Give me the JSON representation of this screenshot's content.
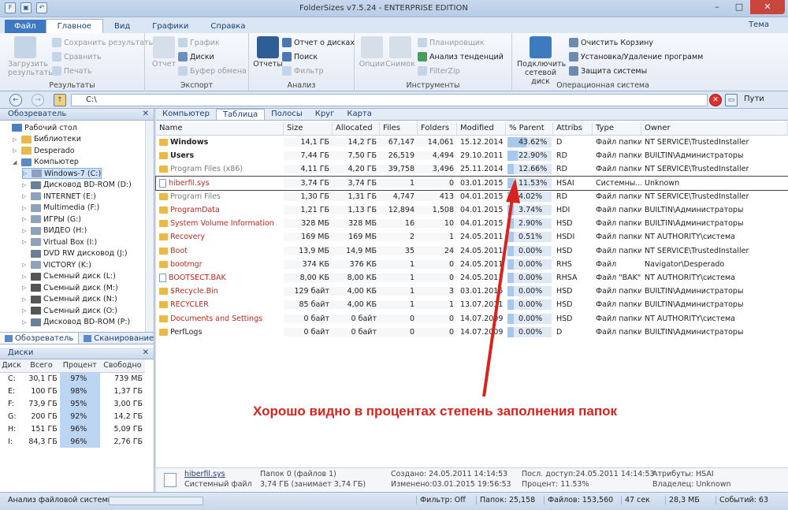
{
  "window": {
    "title": "FolderSizes v7.5.24 - ENTERPRISE EDITION",
    "theme_label": "Тема"
  },
  "ribbon_tabs": [
    "Файл",
    "Главное",
    "Вид",
    "Графики",
    "Справка"
  ],
  "ribbon": {
    "results": {
      "load": "Загрузить результаты",
      "save": "Сохранить результаты",
      "compare": "Сравнить",
      "print": "Печать",
      "label": "Результаты"
    },
    "export": {
      "report": "Отчет",
      "chart": "График",
      "disks": "Диски",
      "clipboard": "Буфер обмена",
      "label": "Экспорт"
    },
    "analysis": {
      "reports": "Отчеты",
      "disk_report": "Отчет о дисках",
      "search": "Поиск",
      "filter": "Фильтр",
      "label": "Анализ"
    },
    "tools": {
      "options": "Опции",
      "snapshot": "Снимок",
      "planner": "Планировщик",
      "trend": "Анализ тенденций",
      "filterzip": "FilterZip",
      "label": "Инструменты"
    },
    "os": {
      "network": "Подключить сетевой диск",
      "recycle": "Очистить Корзину",
      "install": "Установка/Удаление программ",
      "protect": "Защита системы",
      "label": "Операционная система"
    }
  },
  "address": {
    "path": "C:\\",
    "paths_label": "Пути"
  },
  "explorer": {
    "title": "Обозреватель",
    "tree": [
      "Рабочий стол",
      "Библиотеки",
      "Desperado",
      "Компьютер",
      "Windows-7 (C:)",
      "Дисковод BD-ROM (D:)",
      "INTERNET (E:)",
      "Multimedia (F:)",
      "ИГРЫ (G:)",
      "ВИДЕО (H:)",
      "Virtual Box (I:)",
      "DVD RW дисковод (J:)",
      "VICTORY (K:)",
      "Съемный диск (L:)",
      "Съемный диск (M:)",
      "Съемный диск (N:)",
      "Съемный диск (O:)",
      "Дисковод BD-ROM (P:)"
    ],
    "tabs": [
      "Обозреватель",
      "Сканирование"
    ]
  },
  "disks": {
    "title": "Диски",
    "headers": [
      "Диск",
      "Всего",
      "Процент",
      "Свободно"
    ],
    "rows": [
      [
        "C:",
        "30,1 ГБ",
        "97%",
        "739 МБ"
      ],
      [
        "E:",
        "100 ГБ",
        "98%",
        "1,37 ГБ"
      ],
      [
        "F:",
        "73,9 ГБ",
        "95%",
        "3,00 ГБ"
      ],
      [
        "G:",
        "200 ГБ",
        "92%",
        "14,2 ГБ"
      ],
      [
        "H:",
        "151 ГБ",
        "96%",
        "5,09 ГБ"
      ],
      [
        "I:",
        "84,3 ГБ",
        "96%",
        "2,76 ГБ"
      ]
    ]
  },
  "view_tabs": [
    "Компьютер",
    "Таблица",
    "Полосы",
    "Круг",
    "Карта"
  ],
  "table": {
    "headers": [
      "Name",
      "Size",
      "Allocated",
      "Files",
      "Folders",
      "Modified",
      "% Parent",
      "Attribs",
      "Type",
      "Owner"
    ],
    "rows": [
      {
        "name": "Windows",
        "size": "14,1 ГБ",
        "alloc": "14,2 ГБ",
        "files": "67,147",
        "folders": "14,061",
        "mod": "15.12.2014 ...",
        "pct": "43.62%",
        "pv": 43.62,
        "attr": "D",
        "type": "Файл папки",
        "owner": "NT SERVICE\\TrustedInstaller",
        "style": "bold",
        "icon": "folder"
      },
      {
        "name": "Users",
        "size": "7,44 ГБ",
        "alloc": "7,50 ГБ",
        "files": "26,519",
        "folders": "4,494",
        "mod": "29.10.2011 ...",
        "pct": "22.90%",
        "pv": 22.9,
        "attr": "RD",
        "type": "Файл папки",
        "owner": "BUILTIN\\Администраторы",
        "style": "bold",
        "icon": "folder"
      },
      {
        "name": "Program Files (x86)",
        "size": "4,11 ГБ",
        "alloc": "4,20 ГБ",
        "files": "39,758",
        "folders": "3,496",
        "mod": "25.11.2014 ...",
        "pct": "12.66%",
        "pv": 12.66,
        "attr": "RD",
        "type": "Файл папки",
        "owner": "NT SERVICE\\TrustedInstaller",
        "style": "gray",
        "icon": "folder"
      },
      {
        "name": "hiberfil.sys",
        "size": "3,74 ГБ",
        "alloc": "3,74 ГБ",
        "files": "1",
        "folders": "0",
        "mod": "03.01.2015 ...",
        "pct": "11.53%",
        "pv": 11.53,
        "attr": "HSAI",
        "type": "Системны...",
        "owner": "Unknown",
        "style": "red",
        "icon": "file"
      },
      {
        "name": "Program Files",
        "size": "1,30 ГБ",
        "alloc": "1,31 ГБ",
        "files": "4,747",
        "folders": "413",
        "mod": "04.01.2015 ...",
        "pct": "4.02%",
        "pv": 4.02,
        "attr": "RD",
        "type": "Файл папки",
        "owner": "NT SERVICE\\TrustedInstaller",
        "style": "gray",
        "icon": "folder"
      },
      {
        "name": "ProgramData",
        "size": "1,21 ГБ",
        "alloc": "1,13 ГБ",
        "files": "12,894",
        "folders": "1,508",
        "mod": "04.01.2015 ...",
        "pct": "3.74%",
        "pv": 3.74,
        "attr": "HDI",
        "type": "Файл папки",
        "owner": "BUILTIN\\Администраторы",
        "style": "red",
        "icon": "folder"
      },
      {
        "name": "System Volume Information",
        "size": "328 МБ",
        "alloc": "328 МБ",
        "files": "16",
        "folders": "10",
        "mod": "04.01.2015 ...",
        "pct": "2.90%",
        "pv": 2.9,
        "attr": "HSD",
        "type": "Файл папки",
        "owner": "BUILTIN\\Администраторы",
        "style": "red",
        "icon": "folder"
      },
      {
        "name": "Recovery",
        "size": "169 МБ",
        "alloc": "169 МБ",
        "files": "2",
        "folders": "1",
        "mod": "24.05.2011 ...",
        "pct": "0.51%",
        "pv": 0.51,
        "attr": "HSDI",
        "type": "Файл папки",
        "owner": "NT AUTHORITY\\система",
        "style": "red",
        "icon": "folder"
      },
      {
        "name": "Boot",
        "size": "13,9 МБ",
        "alloc": "14,9 МБ",
        "files": "35",
        "folders": "24",
        "mod": "24.05.2011 ...",
        "pct": "0.00%",
        "pv": 0,
        "attr": "HSD",
        "type": "Файл папки",
        "owner": "NT SERVICE\\TrustedInstaller",
        "style": "red",
        "icon": "folder"
      },
      {
        "name": "bootmgr",
        "size": "374 КБ",
        "alloc": "376 КБ",
        "files": "1",
        "folders": "0",
        "mod": "24.05.2011 ...",
        "pct": "0.00%",
        "pv": 0,
        "attr": "RHS",
        "type": "Файл",
        "owner": "Navigator\\Desperado",
        "style": "red",
        "icon": "folder"
      },
      {
        "name": "BOOTSECT.BAK",
        "size": "8,00 КБ",
        "alloc": "8,00 КБ",
        "files": "1",
        "folders": "0",
        "mod": "24.05.2011 ...",
        "pct": "0.00%",
        "pv": 0,
        "attr": "RHSA",
        "type": "Файл \"BAK\"",
        "owner": "NT AUTHORITY\\система",
        "style": "red",
        "icon": "file"
      },
      {
        "name": "$Recycle.Bin",
        "size": "129 байт",
        "alloc": "4,00 КБ",
        "files": "1",
        "folders": "3",
        "mod": "03.01.2015 ...",
        "pct": "0.00%",
        "pv": 0,
        "attr": "HSD",
        "type": "Файл папки",
        "owner": "BUILTIN\\Администраторы",
        "style": "red",
        "icon": "folder"
      },
      {
        "name": "RECYCLER",
        "size": "85 байт",
        "alloc": "4,00 КБ",
        "files": "1",
        "folders": "1",
        "mod": "13.07.2011 ...",
        "pct": "0.00%",
        "pv": 0,
        "attr": "HSD",
        "type": "Файл папки",
        "owner": "BUILTIN\\Администраторы",
        "style": "red",
        "icon": "folder"
      },
      {
        "name": "Documents and Settings",
        "size": "0 байт",
        "alloc": "0 байт",
        "files": "0",
        "folders": "0",
        "mod": "14.07.2009 ...",
        "pct": "0.00%",
        "pv": 0,
        "attr": "HSD",
        "type": "Файл папки",
        "owner": "NT AUTHORITY\\система",
        "style": "red",
        "icon": "folder"
      },
      {
        "name": "PerfLogs",
        "size": "0 байт",
        "alloc": "0 байт",
        "files": "0",
        "folders": "0",
        "mod": "14.07.2009 ...",
        "pct": "0.00%",
        "pv": 0,
        "attr": "D",
        "type": "Файл папки",
        "owner": "BUILTIN\\Администраторы",
        "style": "normal",
        "icon": "folder"
      }
    ]
  },
  "info": {
    "name": "hiberfil.sys",
    "type": "Системный файл",
    "folders": "Папок 0 (файлов 1)",
    "size": "3,74 ГБ (занимает 3,74 ГБ)",
    "created": "Создано: 24.05.2011 14:14:53",
    "modified": "Изменено:03.01.2015 19:56:53",
    "access": "Посл. доступ:24.05.2011 14:14:53",
    "percent": "Процент: 11.53%",
    "attrs": "Атрибуты: HSAI",
    "owner": "Владелец: Unknown"
  },
  "status": {
    "left": "Анализ файловой системы",
    "filter": "Фильтр: Off",
    "folders": "Папок: 25,158",
    "files": "Файлов: 153,560",
    "cols": "47 cек",
    "mem": "28,3 МБ",
    "events": "Событий: 63"
  },
  "annotation": "Хорошо видно в процентах степень заполнения папок",
  "colors": {
    "annotation": "#d8231e",
    "accent": "#3e78c2"
  }
}
